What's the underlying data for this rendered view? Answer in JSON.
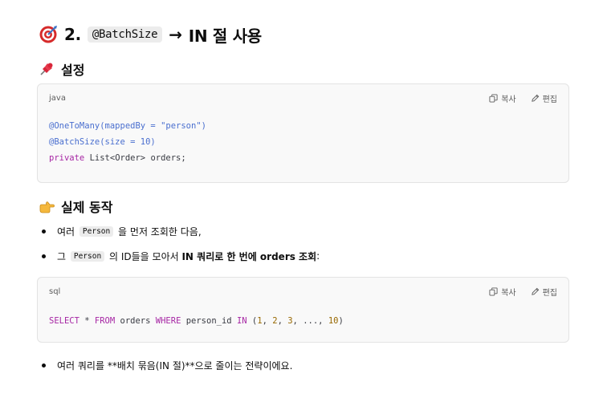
{
  "heading": {
    "number": "2.",
    "code": "@BatchSize",
    "arrow": "→",
    "rest": "IN 절 사용"
  },
  "setup": {
    "title": "설정",
    "code_block": {
      "language": "java",
      "copy_label": "복사",
      "edit_label": "편집",
      "line1": "@OneToMany(mappedBy = \"person\")",
      "line2": "@BatchSize(size = 10)",
      "line3_kw": "private",
      "line3_rest": " List<Order> orders;"
    }
  },
  "behavior": {
    "title": "실제 동작",
    "bullet1": {
      "pre": "여러 ",
      "code": "Person",
      "post": " 을 먼저 조회한 다음,"
    },
    "bullet2": {
      "pre": "그 ",
      "code": "Person",
      "mid": " 의 ID들을 모아서 ",
      "bold": "IN 쿼리로 한 번에 orders 조회",
      "post": ":"
    },
    "code_block": {
      "language": "sql",
      "copy_label": "복사",
      "edit_label": "편집",
      "select": "SELECT",
      "star": " * ",
      "from": "FROM",
      "table": " orders ",
      "where": "WHERE",
      "col": " person_id ",
      "in": "IN",
      "open": " (",
      "n1": "1",
      "c1": ", ",
      "n2": "2",
      "c2": ", ",
      "n3": "3",
      "c3": ", ..., ",
      "n10": "10",
      "close": ")"
    },
    "bullet3": "여러 쿼리를 **배치 묶음(IN 절)**으로 줄이는 전략이에요."
  },
  "colors": {
    "annotation": "#4a6fcf",
    "keyword": "#a626a4",
    "number": "#986801"
  },
  "icons": [
    "target-icon",
    "pushpin-icon",
    "pointing-hand-icon",
    "copy-icon",
    "pencil-icon"
  ]
}
